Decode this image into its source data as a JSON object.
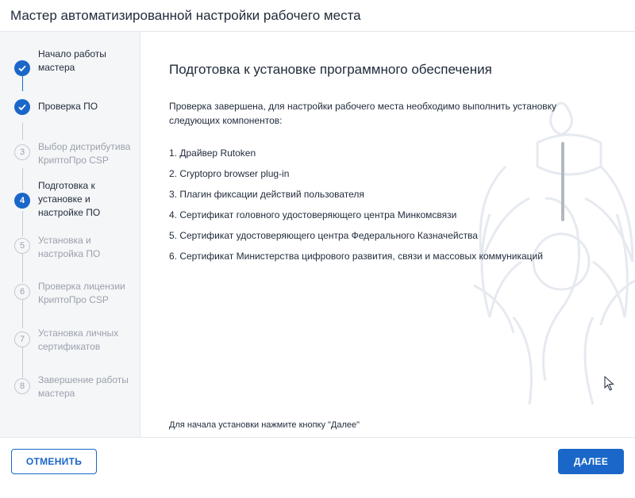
{
  "window": {
    "title": "Мастер автоматизированной настройки рабочего места"
  },
  "steps": [
    {
      "number": "1",
      "label": "Начало работы мастера",
      "state": "done"
    },
    {
      "number": "2",
      "label": "Проверка ПО",
      "state": "done"
    },
    {
      "number": "3",
      "label": "Выбор дистрибутива КриптоПро CSP",
      "state": "future"
    },
    {
      "number": "4",
      "label": "Подготовка к установке и настройке ПО",
      "state": "current"
    },
    {
      "number": "5",
      "label": "Установка и настройка ПО",
      "state": "future"
    },
    {
      "number": "6",
      "label": "Проверка лицензии КриптоПро CSP",
      "state": "future"
    },
    {
      "number": "7",
      "label": "Установка личных сертификатов",
      "state": "future"
    },
    {
      "number": "8",
      "label": "Завершение работы мастера",
      "state": "future"
    }
  ],
  "content": {
    "title": "Подготовка к установке программного обеспечения",
    "intro": "Проверка завершена, для настройки рабочего места необходимо выполнить установку следующих компонентов:",
    "components": [
      "1.  Драйвер Rutoken",
      "2.  Cryptopro browser plug-in",
      "3.  Плагин фиксации действий пользователя",
      "4.  Сертификат головного удостоверяющего центра Минкомсвязи",
      "5.  Сертификат удостоверяющего центра Федерального Казначейства",
      "6.  Сертификат Министерства цифрового развития, связи и массовых коммуникаций"
    ],
    "footer_note": "Для начала установки нажмите кнопку \"Далее\""
  },
  "buttons": {
    "cancel": "ОТМЕНИТЬ",
    "next": "ДАЛЕЕ"
  },
  "icons": {
    "step_done": "checkmark-icon",
    "watermark": "coat-of-arms-icon",
    "cursor": "mouse-pointer-icon"
  },
  "colors": {
    "accent": "#1a67c9",
    "inactive": "#9aa1ac",
    "sidebar_bg": "#f5f6f8"
  }
}
